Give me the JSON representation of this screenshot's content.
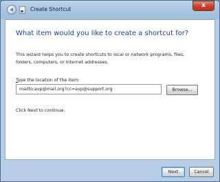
{
  "window": {
    "title": "Create Shortcut",
    "icons": {
      "back": "back-arrow-icon",
      "app": "shortcut-app-icon",
      "close": "close-icon"
    },
    "close_glyph": "x"
  },
  "content": {
    "heading": "What item would you like to create a shortcut for?",
    "description": "This wizard helps you to create shortcuts to local or network programs, files, folders, computers, or Internet addresses.",
    "location_label_prefix": "T",
    "location_label_rest": "ype the location of the item:",
    "location_value": "mailto:avp@mail.org?cc=avp@support.org",
    "browse_label": "Browse...",
    "hint": "Click Next to continue."
  },
  "footer": {
    "next_label": "Next",
    "cancel_label": "Cancel"
  },
  "colors": {
    "heading": "#1a3f8a",
    "frame": "#b7cde6",
    "close": "#c6412c"
  }
}
